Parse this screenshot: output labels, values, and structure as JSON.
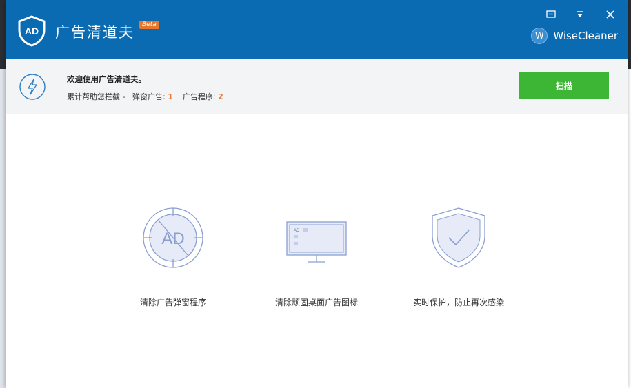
{
  "app": {
    "title": "广告清道夫",
    "beta": "Beta",
    "brand": "WiseCleaner",
    "brand_badge": "W"
  },
  "info": {
    "welcome": "欢迎使用广告清道夫。",
    "stats_prefix": "累计帮助您拦截 -",
    "popup_label": "弹窗广告:",
    "popup_count": "1",
    "adware_label": "广告程序:",
    "adware_count": "2"
  },
  "actions": {
    "scan": "扫描"
  },
  "features": [
    {
      "label": "清除广告弹窗程序",
      "icon": "ad-block-icon"
    },
    {
      "label": "清除顽固桌面广告图标",
      "icon": "desktop-monitor-icon"
    },
    {
      "label": "实时保护，防止再次感染",
      "icon": "shield-check-icon"
    }
  ],
  "colors": {
    "titlebar": "#0a6bb3",
    "scan_button": "#3db535",
    "accent_number": "#e8762d",
    "icon_stroke": "#8a9fd0"
  }
}
